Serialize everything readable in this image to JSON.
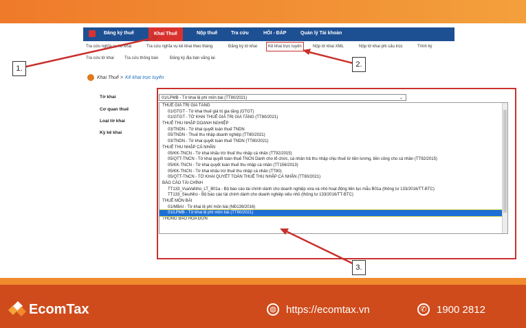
{
  "brand": {
    "name": "EcomTax",
    "url": "https://ecomtax.vn",
    "phone": "1900 2812",
    "colors": {
      "orange": "#ef7a2a",
      "red": "#cf4b1c",
      "nav": "#1d4f93"
    }
  },
  "nav": {
    "items": [
      "Đăng ký thuế",
      "Khai Thuế",
      "Nộp thuế",
      "Tra cứu",
      "HỎI - ĐÁP",
      "Quản lý Tài khoản"
    ],
    "active": "Khai Thuế"
  },
  "subnav": {
    "row1": [
      "Tra cứu nghĩa vụ kê khai",
      "Tra cứu nghĩa vụ kê khai theo tháng",
      "Đăng ký tờ khai",
      "Kê khai trực tuyến",
      "Nộp tờ khai XML",
      "Nộp tờ khai phi cấu trúc",
      "Trình ký"
    ],
    "row2": [
      "Tra cứu tờ khai",
      "Tra cứu thông báo",
      "Đăng ký địa bàn vãng lai"
    ]
  },
  "breadcrumb": {
    "section": "Khai Thuế >",
    "page": "Kê khai trực tuyến"
  },
  "form": {
    "labels": [
      "Tờ khai",
      "Cơ quan thuế",
      "Loại tờ khai",
      "Kỳ kê khai"
    ],
    "selected": "01/LPMB - Tờ khai lệ phí môn bài (TT80/2021)"
  },
  "options": [
    {
      "t": "THUẾ GIÁ TRỊ GIA TĂNG",
      "g": true
    },
    {
      "t": "01/GTGT - Tờ khai thuế giá trị gia tăng (GTGT)"
    },
    {
      "t": "01/GTGT - TỜ KHAI THUẾ GIÁ TRỊ GIA TĂNG (TT80/2021)"
    },
    {
      "t": "THUẾ THU NHẬP DOANH NGHIỆP",
      "g": true
    },
    {
      "t": "03/TNDN - Tờ khai quyết toán thuế TNDN"
    },
    {
      "t": "05/TNDN - Thuế thu nhập doanh nghiệp (TT80/2021)"
    },
    {
      "t": "03/TNDN - Tờ khai quyết toán thuế TNDN (TT80/2021)"
    },
    {
      "t": "THUẾ THU NHẬP CÁ NHÂN",
      "g": true
    },
    {
      "t": "05/KK-TNCN - Tờ khai khấu trừ thuế thu nhập cá nhân (TT92/2015)"
    },
    {
      "t": "05/QTT-TNCN - Tờ khai quyết toán thuế TNCN Dành cho tổ chức, cá nhân trả thu nhập chịu thuế từ tiền lương, tiền công cho cá nhân (TT92/2015)"
    },
    {
      "t": "05/KK-TNCN - Tờ khai quyết toán thuế thu nhập cá nhân (TT156/2013)"
    },
    {
      "t": "05/KK-TNCN - Tờ khai khấu trừ thuế thu nhập cá nhân (TT80)"
    },
    {
      "t": "05/QTT-TNCN - TỜ KHAI QUYẾT TOÁN THUẾ THU NHẬP CÁ NHÂN (TT80/2021)"
    },
    {
      "t": "BÁO CÁO TÀI CHÍNH",
      "g": true
    },
    {
      "t": "TT133_VuaVaNho_LT_B01a - Bộ báo cáo tài chính dành cho doanh nghiệp vừa và nhỏ hoạt động liên tục mẫu B01a (thông tư 133/2016/TT-BTC)"
    },
    {
      "t": "TT133_SieuNho - Bộ báo cáo tài chính dành cho doanh nghiệp siêu nhỏ (thông tư 133/2016/TT-BTC)"
    },
    {
      "t": "THUẾ MÔN BÀI",
      "g": true
    },
    {
      "t": "01/MBAI - Tờ khai lệ phí môn bài (NĐ139/2016)"
    },
    {
      "t": "01/LPMB - Tờ khai lệ phí môn bài (TT80/2021)",
      "sel": true
    },
    {
      "t": "THÔNG BÁO HÓA ĐƠN",
      "g": true
    }
  ],
  "callouts": [
    "1.",
    "2.",
    "3."
  ]
}
